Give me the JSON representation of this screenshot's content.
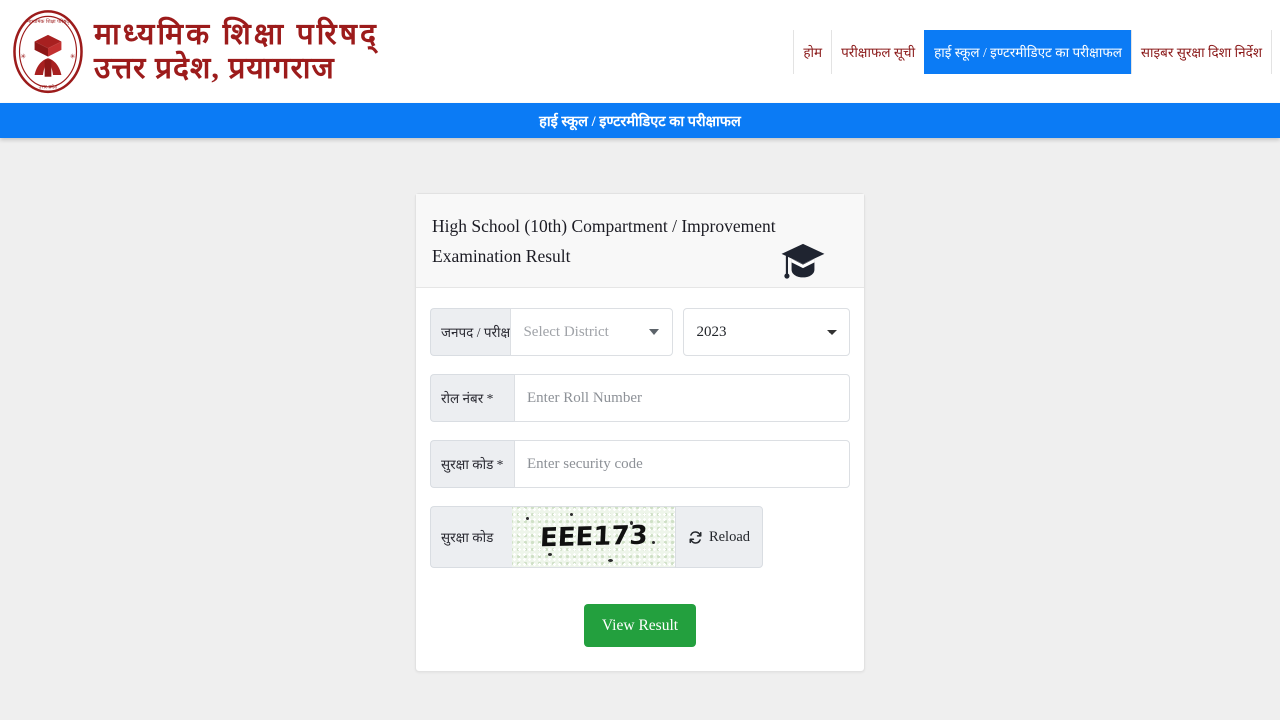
{
  "header": {
    "logo_alt": "up-board-emblem",
    "brand_line1": "माध्यमिक शिक्षा परिषद्",
    "brand_line2": "उत्तर प्रदेश, प्रयागराज",
    "nav": [
      {
        "label": "होम",
        "active": false
      },
      {
        "label": "परीक्षाफल सूची",
        "active": false
      },
      {
        "label": "हाई स्कूल / इण्टरमीडिएट का परीक्षाफल",
        "active": true
      },
      {
        "label": "साइबर सुरक्षा दिशा निर्देश",
        "active": false
      }
    ],
    "accent_blue": "#0b7bf5",
    "brand_red": "#9c1b1b"
  },
  "banner": {
    "title": "हाई स्कूल / इण्टरमीडिएट का परीक्षाफल"
  },
  "card": {
    "title": "High School (10th) Compartment / Improvement Examination Result",
    "icon": "graduation-cap-icon",
    "form": {
      "district_label": "जनपद / परीक्षा ",
      "district_value": "Select District",
      "year_value": "2023",
      "year_options": [
        "2023"
      ],
      "roll_label": "रोल नंबर *",
      "roll_placeholder": "Enter Roll Number",
      "security_label": "सुरक्षा कोड *",
      "security_placeholder": "Enter security code",
      "captcha_label": "सुरक्षा कोड",
      "captcha_text": "EEE173",
      "reload_label": "Reload",
      "submit_label": "View Result",
      "submit_color": "#23a03e"
    }
  }
}
